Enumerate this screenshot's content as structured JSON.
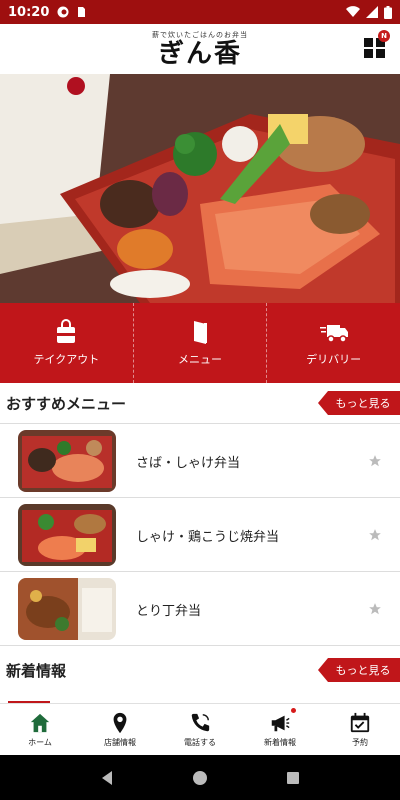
{
  "status_bar": {
    "time": "10:20"
  },
  "header": {
    "logo_sub": "薪で炊いたごはんのお弁当",
    "logo_main": "ぎん香",
    "menu_badge": "N"
  },
  "actions": [
    {
      "label": "テイクアウト",
      "icon": "takeout-bag-icon"
    },
    {
      "label": "メニュー",
      "icon": "menu-book-icon"
    },
    {
      "label": "デリバリー",
      "icon": "delivery-truck-icon"
    }
  ],
  "recommended": {
    "title": "おすすめメニュー",
    "more_label": "もっと見る",
    "items": [
      {
        "name": "さば・しゃけ弁当"
      },
      {
        "name": "しゃけ・鶏こうじ焼弁当"
      },
      {
        "name": "とり丁弁当"
      }
    ]
  },
  "news": {
    "title": "新着情報",
    "more_label": "もっと見る"
  },
  "bottom_nav": [
    {
      "label": "ホーム",
      "icon": "home-icon",
      "active": true
    },
    {
      "label": "店舗情報",
      "icon": "map-pin-icon"
    },
    {
      "label": "電話する",
      "icon": "phone-icon"
    },
    {
      "label": "新着情報",
      "icon": "megaphone-icon",
      "badge": true
    },
    {
      "label": "予約",
      "icon": "calendar-check-icon"
    }
  ],
  "colors": {
    "brand_red": "#c0161a",
    "status_bar": "#9e0f0f",
    "active_green": "#1f6b3b"
  }
}
